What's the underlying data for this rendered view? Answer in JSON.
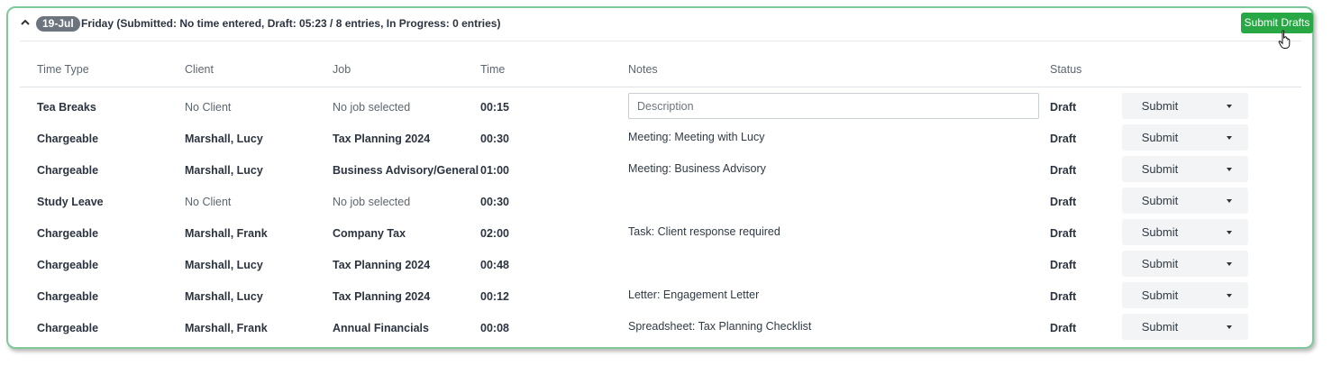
{
  "day": {
    "date_badge": "19-Jul",
    "summary": "Friday (Submitted: No time entered, Draft: 05:23 / 8 entries, In Progress: 0 entries)",
    "submit_drafts_label": "Submit Drafts"
  },
  "columns": {
    "time_type": "Time Type",
    "client": "Client",
    "job": "Job",
    "time": "Time",
    "notes": "Notes",
    "status": "Status"
  },
  "notes_placeholder": "Description",
  "entries": [
    {
      "time_type": "Tea Breaks",
      "client": "No Client",
      "job": "No job selected",
      "time": "00:15",
      "notes": "",
      "status": "Draft",
      "action": "Submit"
    },
    {
      "time_type": "Chargeable",
      "client": "Marshall, Lucy",
      "job": "Tax Planning 2024",
      "time": "00:30",
      "notes": "Meeting: Meeting with Lucy",
      "status": "Draft",
      "action": "Submit"
    },
    {
      "time_type": "Chargeable",
      "client": "Marshall, Lucy",
      "job": "Business Advisory/General",
      "time": "01:00",
      "notes": "Meeting: Business Advisory",
      "status": "Draft",
      "action": "Submit"
    },
    {
      "time_type": "Study Leave",
      "client": "No Client",
      "job": "No job selected",
      "time": "00:30",
      "notes": "",
      "status": "Draft",
      "action": "Submit"
    },
    {
      "time_type": "Chargeable",
      "client": "Marshall, Frank",
      "job": "Company Tax",
      "time": "02:00",
      "notes": "Task: Client response required",
      "status": "Draft",
      "action": "Submit"
    },
    {
      "time_type": "Chargeable",
      "client": "Marshall, Lucy",
      "job": "Tax Planning 2024",
      "time": "00:48",
      "notes": "",
      "status": "Draft",
      "action": "Submit"
    },
    {
      "time_type": "Chargeable",
      "client": "Marshall, Lucy",
      "job": "Tax Planning 2024",
      "time": "00:12",
      "notes": "Letter: Engagement Letter",
      "status": "Draft",
      "action": "Submit"
    },
    {
      "time_type": "Chargeable",
      "client": "Marshall, Frank",
      "job": "Annual Financials",
      "time": "00:08",
      "notes": "Spreadsheet: Tax Planning Checklist",
      "status": "Draft",
      "action": "Submit"
    }
  ],
  "colors": {
    "accent_green": "#28a745",
    "panel_border": "#7fc89b",
    "badge_gray": "#6c757d"
  },
  "icons": {
    "collapse": "chevron-up-icon",
    "dropdown": "caret-down-icon",
    "cursor": "hand-pointer-icon"
  }
}
